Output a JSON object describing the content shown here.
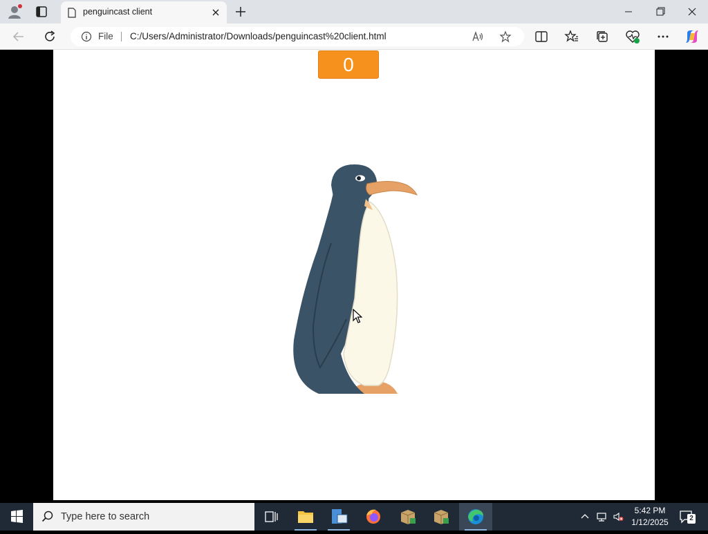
{
  "browser": {
    "tab_title": "penguincast client",
    "address_scheme": "File",
    "address_url": "C:/Users/Administrator/Downloads/penguincast%20client.html"
  },
  "game": {
    "score": "0",
    "colors": {
      "score_bg": "#f7911e",
      "penguin_body": "#3b5366",
      "penguin_belly": "#fbf8e8",
      "penguin_beak": "#e6a266"
    }
  },
  "taskbar": {
    "search_placeholder": "Type here to search",
    "time": "5:42 PM",
    "date": "1/12/2025",
    "notification_count": "2"
  }
}
